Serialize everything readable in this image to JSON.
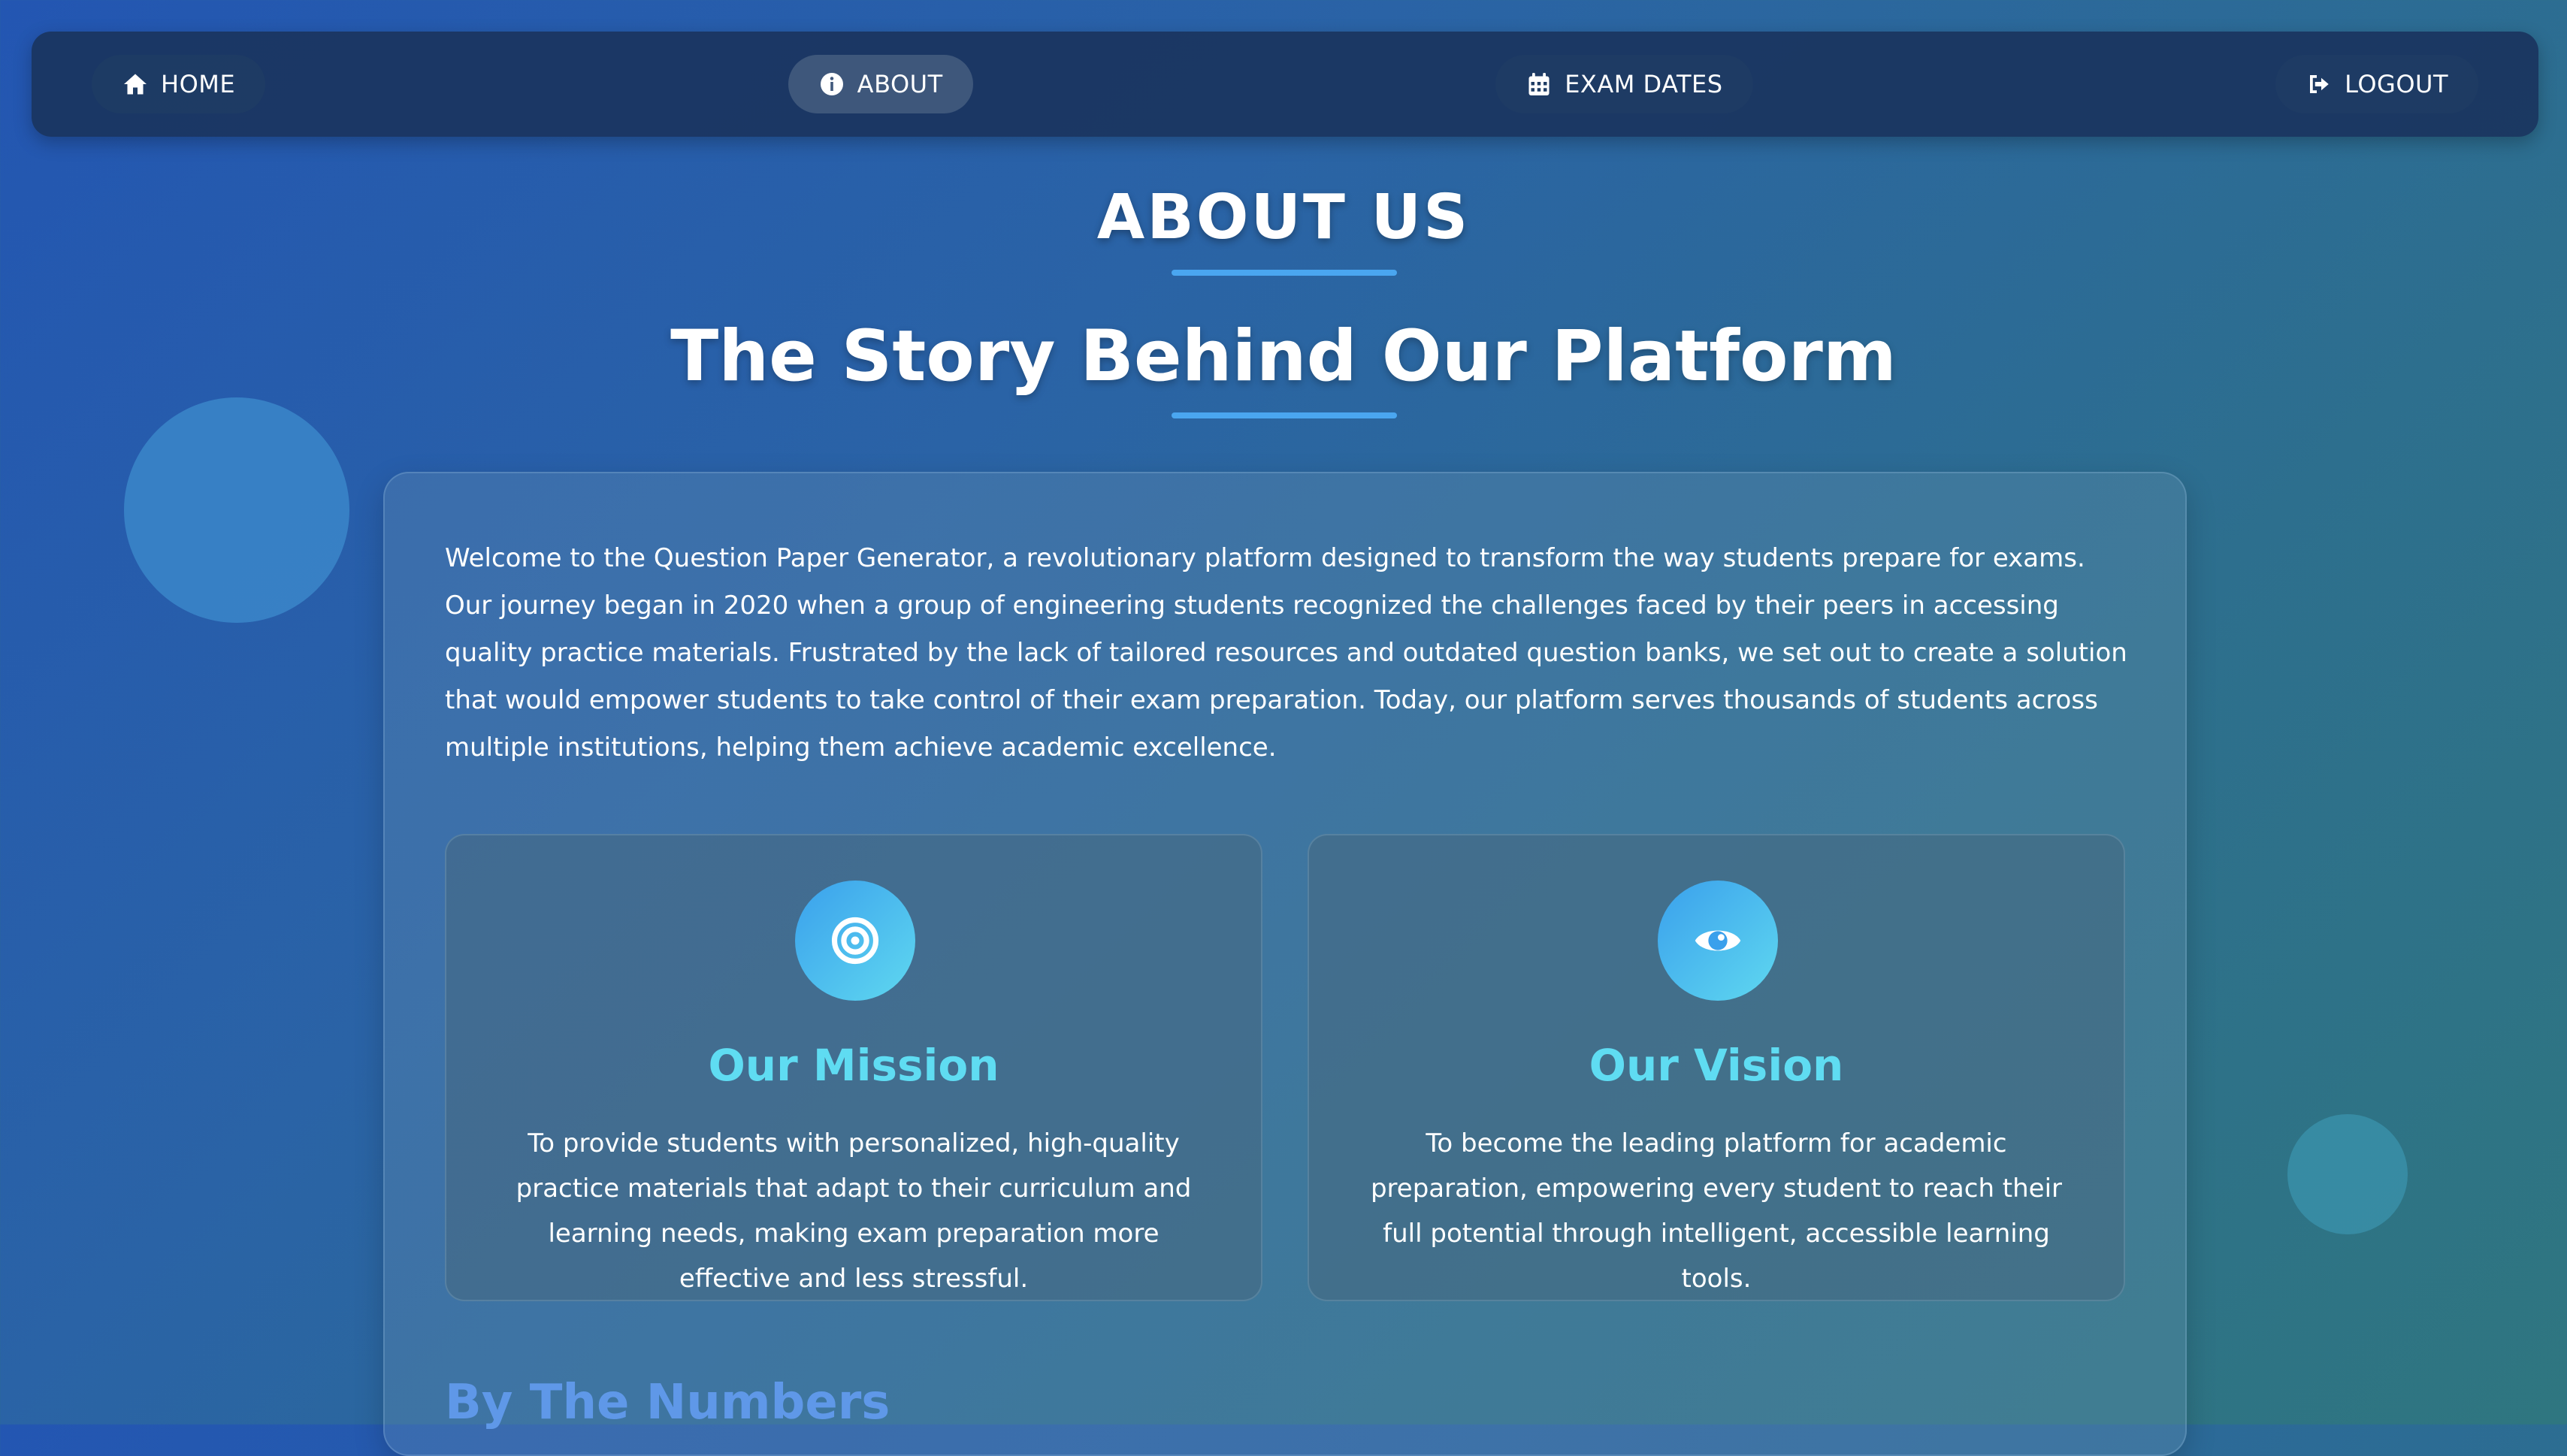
{
  "nav": {
    "items": [
      {
        "label": "HOME",
        "icon": "home-icon"
      },
      {
        "label": "ABOUT",
        "icon": "info-icon"
      },
      {
        "label": "EXAM DATES",
        "icon": "calendar-icon"
      },
      {
        "label": "LOGOUT",
        "icon": "logout-icon"
      }
    ],
    "active": "ABOUT"
  },
  "page": {
    "heading": "ABOUT US",
    "subtitle": "The Story Behind Our Platform",
    "intro": "Welcome to the Question Paper Generator, a revolutionary platform designed to transform the way students prepare for exams. Our journey began in 2020 when a group of engineering students recognized the challenges faced by their peers in accessing quality practice materials. Frustrated by the lack of tailored resources and outdated question banks, we set out to create a solution that would empower students to take control of their exam preparation. Today, our platform serves thousands of students across multiple institutions, helping them achieve academic excellence."
  },
  "cards": {
    "mission": {
      "icon": "target-icon",
      "title": "Our Mission",
      "text": "To provide students with personalized, high-quality practice materials that adapt to their curriculum and learning needs, making exam preparation more effective and less stressful."
    },
    "vision": {
      "icon": "eye-icon",
      "title": "Our Vision",
      "text": "To become the leading platform for academic preparation, empowering every student to reach their full potential through intelligent, accessible learning tools."
    }
  },
  "numbers_section": {
    "heading": "By The Numbers"
  },
  "colors": {
    "accent_cyan": "#5fdcf2",
    "accent_blue": "#4aa6f0",
    "section_heading": "#5f98e8",
    "navbar": "#1a345e"
  }
}
